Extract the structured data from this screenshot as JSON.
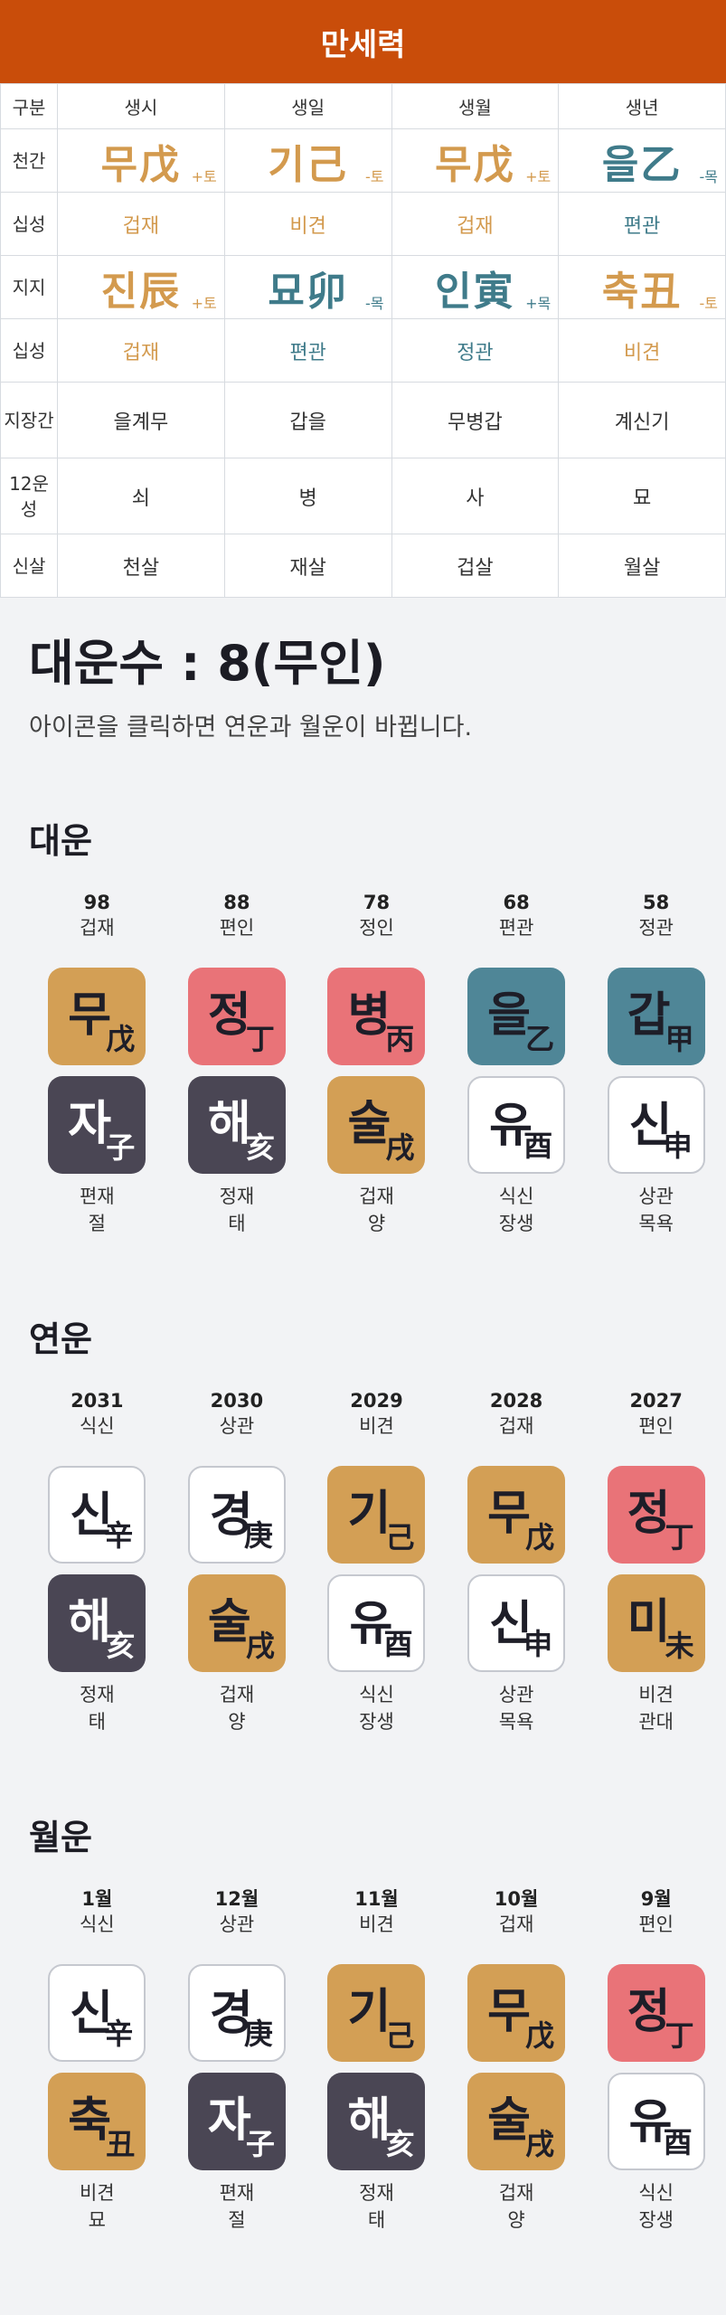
{
  "app_title": "만세력",
  "table": {
    "headers": [
      "구분",
      "생시",
      "생일",
      "생월",
      "생년"
    ],
    "rows": [
      {
        "label": "천간",
        "type": "big",
        "cells": [
          {
            "text": "무戊",
            "sup": "+토",
            "color": "earth"
          },
          {
            "text": "기己",
            "sup": "-토",
            "color": "earth"
          },
          {
            "text": "무戊",
            "sup": "+토",
            "color": "earth"
          },
          {
            "text": "을乙",
            "sup": "-목",
            "color": "wood"
          }
        ]
      },
      {
        "label": "십성",
        "type": "rel",
        "cells": [
          {
            "text": "겁재",
            "color": "earth"
          },
          {
            "text": "비견",
            "color": "earth"
          },
          {
            "text": "겁재",
            "color": "earth"
          },
          {
            "text": "편관",
            "color": "wood"
          }
        ]
      },
      {
        "label": "지지",
        "type": "big",
        "cells": [
          {
            "text": "진辰",
            "sup": "+토",
            "color": "earth"
          },
          {
            "text": "묘卯",
            "sup": "-목",
            "color": "wood"
          },
          {
            "text": "인寅",
            "sup": "+목",
            "color": "wood"
          },
          {
            "text": "축丑",
            "sup": "-토",
            "color": "earth"
          }
        ]
      },
      {
        "label": "십성",
        "type": "rel",
        "cells": [
          {
            "text": "겁재",
            "color": "earth"
          },
          {
            "text": "편관",
            "color": "wood"
          },
          {
            "text": "정관",
            "color": "wood"
          },
          {
            "text": "비견",
            "color": "earth"
          }
        ]
      },
      {
        "label": "지장간",
        "type": "plain",
        "cells": [
          {
            "text": "을계무"
          },
          {
            "text": "갑을"
          },
          {
            "text": "무병갑"
          },
          {
            "text": "계신기"
          }
        ]
      },
      {
        "label": "12운성",
        "type": "plain",
        "cells": [
          {
            "text": "쇠"
          },
          {
            "text": "병"
          },
          {
            "text": "사"
          },
          {
            "text": "묘"
          }
        ]
      },
      {
        "label": "신살",
        "type": "plain",
        "cells": [
          {
            "text": "천살"
          },
          {
            "text": "재살"
          },
          {
            "text": "겁살"
          },
          {
            "text": "월살"
          }
        ]
      }
    ]
  },
  "daeunsu_title": "대운수 : 8(무인)",
  "hint": "아이콘을 클릭하면 연운과 월운이 바뀝니다.",
  "colors": {
    "header_bg": "#c94d0a",
    "earth": "#d39f55",
    "fire": "#e97378",
    "wood": "#4f8697",
    "water": "#4a4654",
    "metal": "#ffffff",
    "text_earth": "#d39a4e",
    "text_wood": "#3f7b8a"
  },
  "sections": [
    {
      "title": "대운",
      "items": [
        {
          "top": "98",
          "sub": "겁재",
          "t1": {
            "ko": "무",
            "han": "戊",
            "el": "earth"
          },
          "t2": {
            "ko": "자",
            "han": "子",
            "el": "water"
          },
          "b1": "편재",
          "b2": "절"
        },
        {
          "top": "88",
          "sub": "편인",
          "t1": {
            "ko": "정",
            "han": "丁",
            "el": "fire"
          },
          "t2": {
            "ko": "해",
            "han": "亥",
            "el": "water"
          },
          "b1": "정재",
          "b2": "태"
        },
        {
          "top": "78",
          "sub": "정인",
          "t1": {
            "ko": "병",
            "han": "丙",
            "el": "fire"
          },
          "t2": {
            "ko": "술",
            "han": "戌",
            "el": "earth"
          },
          "b1": "겁재",
          "b2": "양"
        },
        {
          "top": "68",
          "sub": "편관",
          "t1": {
            "ko": "을",
            "han": "乙",
            "el": "wood"
          },
          "t2": {
            "ko": "유",
            "han": "酉",
            "el": "metal"
          },
          "b1": "식신",
          "b2": "장생"
        },
        {
          "top": "58",
          "sub": "정관",
          "t1": {
            "ko": "갑",
            "han": "甲",
            "el": "wood"
          },
          "t2": {
            "ko": "신",
            "han": "申",
            "el": "metal"
          },
          "b1": "상관",
          "b2": "목욕"
        }
      ]
    },
    {
      "title": "연운",
      "items": [
        {
          "top": "2031",
          "sub": "식신",
          "t1": {
            "ko": "신",
            "han": "辛",
            "el": "metal"
          },
          "t2": {
            "ko": "해",
            "han": "亥",
            "el": "water"
          },
          "b1": "정재",
          "b2": "태"
        },
        {
          "top": "2030",
          "sub": "상관",
          "t1": {
            "ko": "경",
            "han": "庚",
            "el": "metal"
          },
          "t2": {
            "ko": "술",
            "han": "戌",
            "el": "earth"
          },
          "b1": "겁재",
          "b2": "양"
        },
        {
          "top": "2029",
          "sub": "비견",
          "t1": {
            "ko": "기",
            "han": "己",
            "el": "earth"
          },
          "t2": {
            "ko": "유",
            "han": "酉",
            "el": "metal"
          },
          "b1": "식신",
          "b2": "장생"
        },
        {
          "top": "2028",
          "sub": "겁재",
          "t1": {
            "ko": "무",
            "han": "戊",
            "el": "earth"
          },
          "t2": {
            "ko": "신",
            "han": "申",
            "el": "metal"
          },
          "b1": "상관",
          "b2": "목욕"
        },
        {
          "top": "2027",
          "sub": "편인",
          "t1": {
            "ko": "정",
            "han": "丁",
            "el": "fire"
          },
          "t2": {
            "ko": "미",
            "han": "未",
            "el": "earth"
          },
          "b1": "비견",
          "b2": "관대"
        }
      ]
    },
    {
      "title": "월운",
      "items": [
        {
          "top": "1월",
          "sub": "식신",
          "t1": {
            "ko": "신",
            "han": "辛",
            "el": "metal"
          },
          "t2": {
            "ko": "축",
            "han": "丑",
            "el": "earth"
          },
          "b1": "비견",
          "b2": "묘"
        },
        {
          "top": "12월",
          "sub": "상관",
          "t1": {
            "ko": "경",
            "han": "庚",
            "el": "metal"
          },
          "t2": {
            "ko": "자",
            "han": "子",
            "el": "water"
          },
          "b1": "편재",
          "b2": "절"
        },
        {
          "top": "11월",
          "sub": "비견",
          "t1": {
            "ko": "기",
            "han": "己",
            "el": "earth"
          },
          "t2": {
            "ko": "해",
            "han": "亥",
            "el": "water"
          },
          "b1": "정재",
          "b2": "태"
        },
        {
          "top": "10월",
          "sub": "겁재",
          "t1": {
            "ko": "무",
            "han": "戊",
            "el": "earth"
          },
          "t2": {
            "ko": "술",
            "han": "戌",
            "el": "earth"
          },
          "b1": "겁재",
          "b2": "양"
        },
        {
          "top": "9월",
          "sub": "편인",
          "t1": {
            "ko": "정",
            "han": "丁",
            "el": "fire"
          },
          "t2": {
            "ko": "유",
            "han": "酉",
            "el": "metal"
          },
          "b1": "식신",
          "b2": "장생"
        }
      ]
    }
  ]
}
